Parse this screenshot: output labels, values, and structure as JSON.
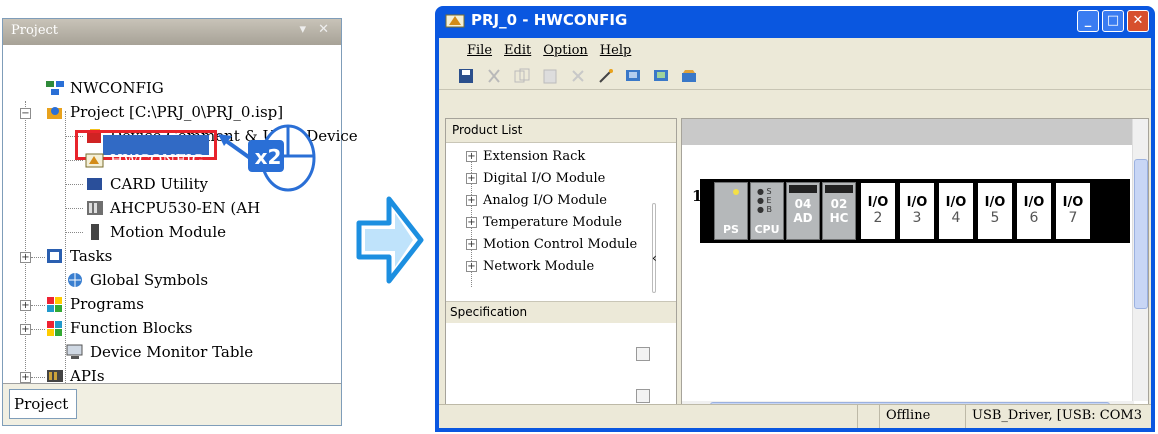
{
  "project_panel": {
    "title": "Project",
    "tab": "Project",
    "tree": [
      {
        "label": "NWCONFIG",
        "icon": "network-icon"
      },
      {
        "label": "Project [C:\\PRJ_0\\PRJ_0.isp]",
        "icon": "project-icon"
      },
      {
        "label": "Device Comment & Used Device",
        "icon": "comment-icon"
      },
      {
        "label": "HWCONFIG",
        "icon": "hwconfig-icon"
      },
      {
        "label": "CARD Utility",
        "icon": "card-icon"
      },
      {
        "label": "AHCPU530-EN (AH",
        "icon": "cpu-icon"
      },
      {
        "label": "Motion Module",
        "icon": "motion-icon"
      },
      {
        "label": "Tasks",
        "icon": "tasks-icon"
      },
      {
        "label": "Global Symbols",
        "icon": "globe-icon"
      },
      {
        "label": "Programs",
        "icon": "programs-icon"
      },
      {
        "label": "Function Blocks",
        "icon": "function-blocks-icon"
      },
      {
        "label": "Device Monitor Table",
        "icon": "monitor-icon"
      },
      {
        "label": "APIs",
        "icon": "apis-icon"
      }
    ]
  },
  "callout": {
    "text": "x2",
    "icon": "mouse-icon"
  },
  "window": {
    "title": "PRJ_0 - HWCONFIG",
    "menu": [
      "File",
      "Edit",
      "Option",
      "Help"
    ],
    "product_list": {
      "header": "Product List",
      "items": [
        "Extension Rack",
        "Digital I/O Module",
        "Analog I/O Module",
        "Temperature Module",
        "Motion Control Module",
        "Network Module"
      ]
    },
    "specification": "Specification",
    "rack": {
      "row_number": "1",
      "modules": [
        {
          "top": "",
          "bottom": "PS"
        },
        {
          "top": "",
          "bottom": "CPU"
        },
        {
          "top": "04",
          "bottom": "AD"
        },
        {
          "top": "02",
          "bottom": "HC"
        }
      ],
      "slots": [
        {
          "label": "I/O",
          "num": "2"
        },
        {
          "label": "I/O",
          "num": "3"
        },
        {
          "label": "I/O",
          "num": "4"
        },
        {
          "label": "I/O",
          "num": "5"
        },
        {
          "label": "I/O",
          "num": "6"
        },
        {
          "label": "I/O",
          "num": "7"
        }
      ]
    },
    "status": {
      "mode": "Offline",
      "connection": "USB_Driver, [USB: COM3"
    }
  }
}
